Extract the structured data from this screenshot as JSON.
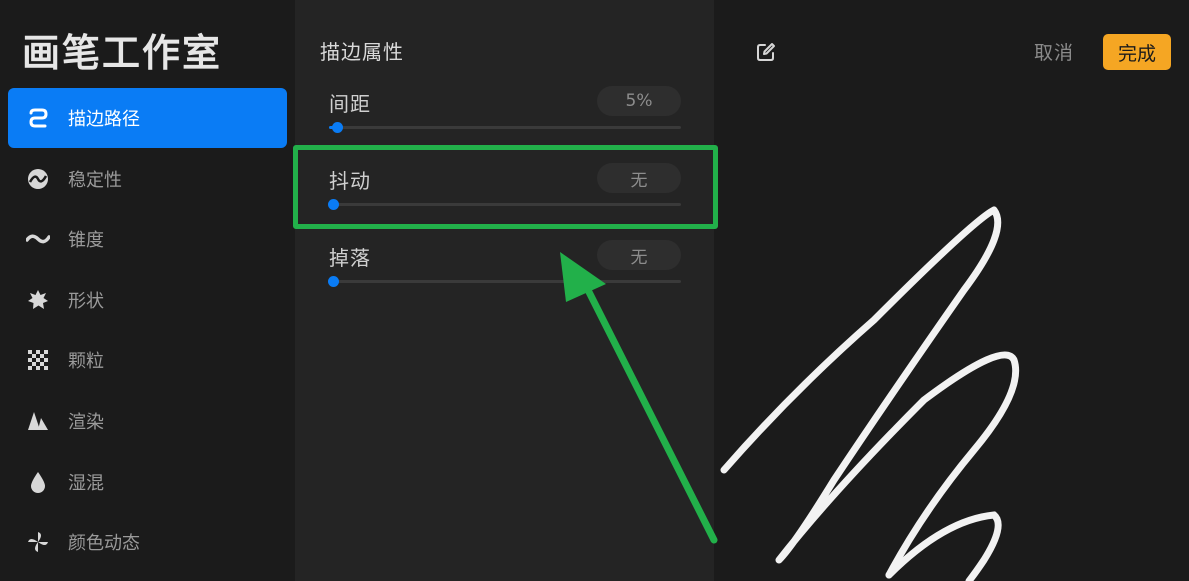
{
  "sidebar": {
    "title": "画笔工作室",
    "items": [
      {
        "label": "描边路径",
        "icon": "stroke-path-icon",
        "active": true
      },
      {
        "label": "稳定性",
        "icon": "stabilization-icon"
      },
      {
        "label": "锥度",
        "icon": "taper-icon"
      },
      {
        "label": "形状",
        "icon": "shape-icon"
      },
      {
        "label": "颗粒",
        "icon": "grain-icon"
      },
      {
        "label": "渲染",
        "icon": "rendering-icon"
      },
      {
        "label": "湿混",
        "icon": "wet-mix-icon"
      },
      {
        "label": "颜色动态",
        "icon": "color-dynamics-icon"
      }
    ]
  },
  "panel": {
    "title": "描边属性",
    "properties": [
      {
        "label": "间距",
        "value": "5%",
        "level": 0.05
      },
      {
        "label": "抖动",
        "value": "无",
        "level": 0
      },
      {
        "label": "掉落",
        "value": "无",
        "level": 0
      }
    ]
  },
  "preview": {
    "cancel_label": "取消",
    "done_label": "完成",
    "edit_icon": "edit-icon"
  },
  "colors": {
    "accent": "#0a7cf5",
    "done": "#f5a623",
    "highlight": "#22b04a"
  }
}
